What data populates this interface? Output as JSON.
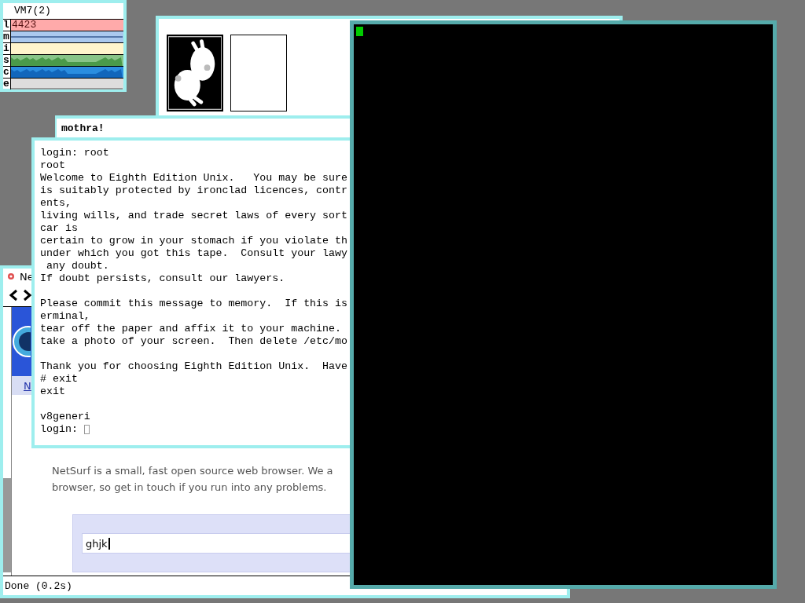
{
  "stats_window": {
    "title": "VM7(2)",
    "rows": [
      {
        "label": "l",
        "reading": "4423",
        "color": "#ffaaaa"
      },
      {
        "label": "m",
        "color": "#aac8ee"
      },
      {
        "label": "i",
        "color": "#fff4cc"
      },
      {
        "label": "s",
        "color": "#88c488"
      },
      {
        "label": "c",
        "color": "#2a8ee0"
      },
      {
        "label": "e",
        "color": "#dddddd"
      }
    ]
  },
  "image_window": {
    "cards": [
      {
        "kind": "picture"
      },
      {
        "kind": "blank"
      }
    ]
  },
  "label_window": {
    "text": "mothra!"
  },
  "terminal_window": {
    "paragraphs": [
      [
        "login: root",
        "root",
        "Welcome to Eighth Edition Unix.   You may be sure",
        "is suitably protected by ironclad licences, contr",
        "ents,",
        "living wills, and trade secret laws of every sort",
        "car is",
        "certain to grow in your stomach if you violate th",
        "under which you got this tape.  Consult your lawy",
        " any doubt.",
        "If doubt persists, consult our lawyers."
      ],
      [
        "Please commit this message to memory.  If this is",
        "erminal,",
        "tear off the paper and affix it to your machine.",
        "take a photo of your screen.  Then delete /etc/mo"
      ],
      [
        "Thank you for choosing Eighth Edition Unix.  Have",
        "# exit",
        "exit"
      ],
      [
        "v8generi",
        "login: "
      ]
    ],
    "cursor": true
  },
  "browser_window": {
    "title": "Ne",
    "nav_link": "N",
    "paragraph_lines": [
      "NetSurf is a small, fast open source web browser. We a",
      "browser, so get in touch if you run into any problems."
    ],
    "search": {
      "value": "ghjk"
    },
    "status": "Done (0.2s)"
  },
  "console_window": {
    "cursor": true
  }
}
